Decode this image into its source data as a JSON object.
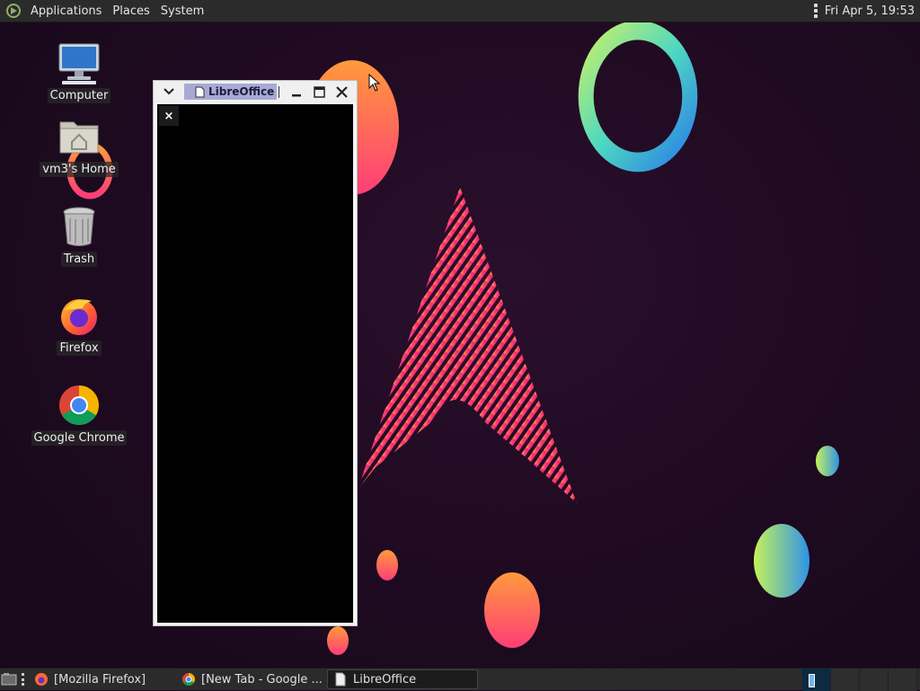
{
  "top_panel": {
    "menus": [
      "Applications",
      "Places",
      "System"
    ],
    "clock": "Fri Apr  5, 19:53",
    "logo_icon": "distro-logo-icon",
    "overflow_icon": "vertical-dots-icon"
  },
  "desktop": {
    "icons": [
      {
        "label": "Computer",
        "icon": "computer-icon"
      },
      {
        "label": "vm3's Home",
        "icon": "home-folder-icon"
      },
      {
        "label": "Trash",
        "icon": "trash-icon"
      },
      {
        "label": "Firefox",
        "icon": "firefox-icon"
      },
      {
        "label": "Google Chrome",
        "icon": "chrome-icon"
      }
    ]
  },
  "window": {
    "tab_title": "LibreOffice",
    "inner_close_glyph": "×"
  },
  "taskbar": {
    "tasks": [
      {
        "label": "[Mozilla Firefox]",
        "icon": "firefox-icon",
        "active": false
      },
      {
        "label": "[New Tab - Google ...",
        "icon": "chrome-icon",
        "active": false
      },
      {
        "label": "LibreOffice",
        "icon": "document-icon",
        "active": true
      }
    ],
    "workspace_count": 4,
    "current_workspace": 1
  },
  "colors": {
    "panel": "#2b2b2b",
    "desktop_bg": "#1e0a20",
    "active_tab": "#a9a9d6"
  }
}
